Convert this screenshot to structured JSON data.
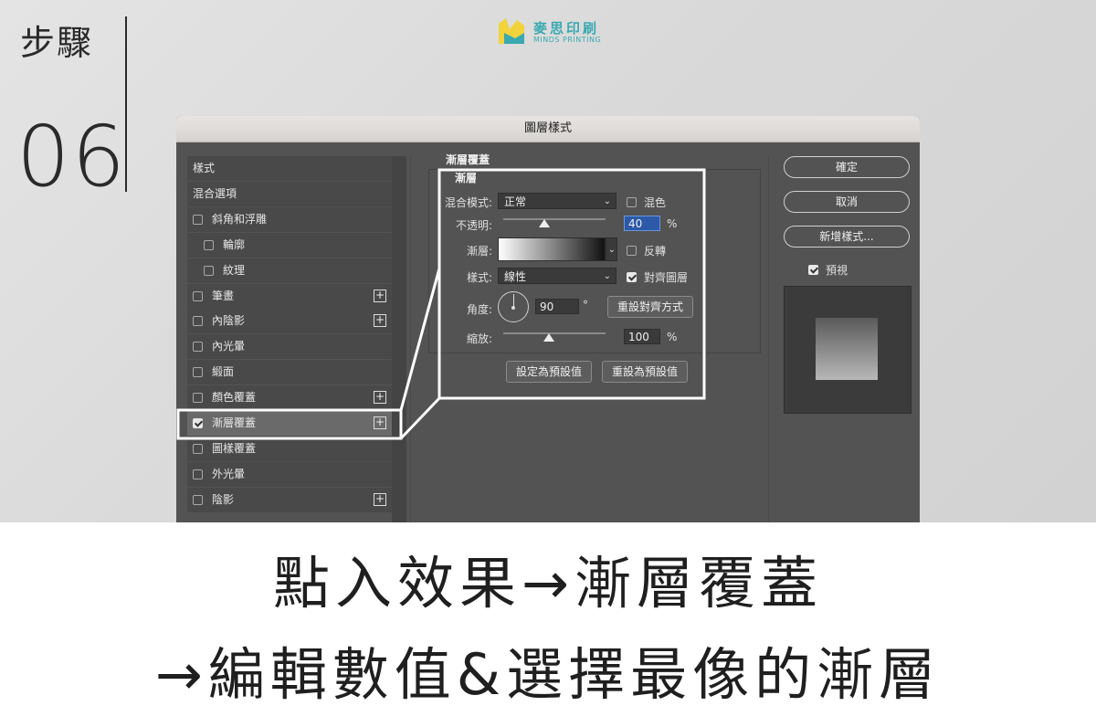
{
  "step": {
    "label": "步驟",
    "number": "06"
  },
  "logo": {
    "cn": "麥思印刷",
    "en": "MINDS PRINTING"
  },
  "dialog": {
    "title": "圖層樣式",
    "styles_list": [
      {
        "label": "樣式",
        "checkbox": false,
        "plus": false,
        "checked": false,
        "indent": 0
      },
      {
        "label": "混合選項",
        "checkbox": false,
        "plus": false,
        "checked": false,
        "indent": 0
      },
      {
        "label": "斜角和浮雕",
        "checkbox": true,
        "plus": false,
        "checked": false,
        "indent": 0
      },
      {
        "label": "輪廓",
        "checkbox": true,
        "plus": false,
        "checked": false,
        "indent": 1
      },
      {
        "label": "紋理",
        "checkbox": true,
        "plus": false,
        "checked": false,
        "indent": 1
      },
      {
        "label": "筆畫",
        "checkbox": true,
        "plus": true,
        "checked": false,
        "indent": 0
      },
      {
        "label": "內陰影",
        "checkbox": true,
        "plus": true,
        "checked": false,
        "indent": 0
      },
      {
        "label": "內光暈",
        "checkbox": true,
        "plus": false,
        "checked": false,
        "indent": 0
      },
      {
        "label": "緞面",
        "checkbox": true,
        "plus": false,
        "checked": false,
        "indent": 0
      },
      {
        "label": "顏色覆蓋",
        "checkbox": true,
        "plus": true,
        "checked": false,
        "indent": 0
      },
      {
        "label": "漸層覆蓋",
        "checkbox": true,
        "plus": true,
        "checked": true,
        "indent": 0,
        "selected": true
      },
      {
        "label": "圖樣覆蓋",
        "checkbox": true,
        "plus": false,
        "checked": false,
        "indent": 0
      },
      {
        "label": "外光暈",
        "checkbox": true,
        "plus": false,
        "checked": false,
        "indent": 0
      },
      {
        "label": "陰影",
        "checkbox": true,
        "plus": true,
        "checked": false,
        "indent": 0
      }
    ],
    "section_title": "漸層覆蓋",
    "group_title": "漸層",
    "blend_mode": {
      "label": "混合模式:",
      "value": "正常"
    },
    "dither": {
      "label": "混色",
      "checked": false
    },
    "opacity": {
      "label": "不透明:",
      "value": "40",
      "unit": "%",
      "fraction": 0.4
    },
    "gradient": {
      "label": "漸層:"
    },
    "reverse": {
      "label": "反轉",
      "checked": false
    },
    "style": {
      "label": "樣式:",
      "value": "線性"
    },
    "align_layer": {
      "label": "對齊圖層",
      "checked": true
    },
    "angle": {
      "label": "角度:",
      "value": "90",
      "unit": "°"
    },
    "reset_alignment": "重設對齊方式",
    "scale": {
      "label": "縮放:",
      "value": "100",
      "unit": "%",
      "fraction": 0.45
    },
    "make_default": "設定為預設值",
    "reset_default": "重設為預設值",
    "buttons": {
      "ok": "確定",
      "cancel": "取消",
      "new_style": "新增樣式..."
    },
    "preview": {
      "label": "預視",
      "checked": true
    }
  },
  "caption": {
    "line1": "點入效果→漸層覆蓋",
    "line2": "→編輯數值&選擇最像的漸層"
  }
}
